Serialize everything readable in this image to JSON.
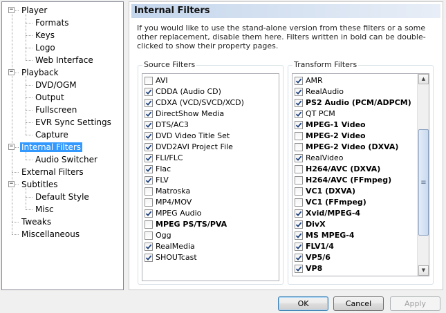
{
  "tree": {
    "items": [
      {
        "label": "Player",
        "level": 0,
        "expander": "−",
        "selected": false
      },
      {
        "label": "Formats",
        "level": 1,
        "selected": false
      },
      {
        "label": "Keys",
        "level": 1,
        "selected": false
      },
      {
        "label": "Logo",
        "level": 1,
        "selected": false
      },
      {
        "label": "Web Interface",
        "level": 1,
        "selected": false
      },
      {
        "label": "Playback",
        "level": 0,
        "expander": "−",
        "selected": false
      },
      {
        "label": "DVD/OGM",
        "level": 1,
        "selected": false
      },
      {
        "label": "Output",
        "level": 1,
        "selected": false
      },
      {
        "label": "Fullscreen",
        "level": 1,
        "selected": false
      },
      {
        "label": "EVR Sync Settings",
        "level": 1,
        "selected": false
      },
      {
        "label": "Capture",
        "level": 1,
        "selected": false
      },
      {
        "label": "Internal Filters",
        "level": 0,
        "expander": "−",
        "selected": true
      },
      {
        "label": "Audio Switcher",
        "level": 1,
        "selected": false
      },
      {
        "label": "External Filters",
        "level": 0,
        "selected": false
      },
      {
        "label": "Subtitles",
        "level": 0,
        "expander": "−",
        "selected": false
      },
      {
        "label": "Default Style",
        "level": 1,
        "selected": false
      },
      {
        "label": "Misc",
        "level": 1,
        "selected": false
      },
      {
        "label": "Tweaks",
        "level": 0,
        "selected": false
      },
      {
        "label": "Miscellaneous",
        "level": 0,
        "selected": false
      }
    ]
  },
  "page": {
    "title": "Internal Filters",
    "description": "If you would like to use the stand-alone version from these filters or a some other replacement, disable them here. Filters written in bold can be double-clicked to show their property pages."
  },
  "source_filters": {
    "label": "Source Filters",
    "items": [
      {
        "label": "AVI",
        "checked": false,
        "bold": false
      },
      {
        "label": "CDDA (Audio CD)",
        "checked": true,
        "bold": false
      },
      {
        "label": "CDXA (VCD/SVCD/XCD)",
        "checked": true,
        "bold": false
      },
      {
        "label": "DirectShow Media",
        "checked": true,
        "bold": false
      },
      {
        "label": "DTS/AC3",
        "checked": true,
        "bold": false
      },
      {
        "label": "DVD Video Title Set",
        "checked": true,
        "bold": false
      },
      {
        "label": "DVD2AVI Project File",
        "checked": true,
        "bold": false
      },
      {
        "label": "FLI/FLC",
        "checked": true,
        "bold": false
      },
      {
        "label": "Flac",
        "checked": true,
        "bold": false
      },
      {
        "label": "FLV",
        "checked": true,
        "bold": false
      },
      {
        "label": "Matroska",
        "checked": false,
        "bold": false
      },
      {
        "label": "MP4/MOV",
        "checked": false,
        "bold": false
      },
      {
        "label": "MPEG Audio",
        "checked": true,
        "bold": false
      },
      {
        "label": "MPEG PS/TS/PVA",
        "checked": false,
        "bold": true
      },
      {
        "label": "Ogg",
        "checked": false,
        "bold": false
      },
      {
        "label": "RealMedia",
        "checked": true,
        "bold": false
      },
      {
        "label": "SHOUTcast",
        "checked": true,
        "bold": false
      }
    ]
  },
  "transform_filters": {
    "label": "Transform Filters",
    "items": [
      {
        "label": "AMR",
        "checked": true,
        "bold": false
      },
      {
        "label": "RealAudio",
        "checked": true,
        "bold": false
      },
      {
        "label": "PS2 Audio (PCM/ADPCM)",
        "checked": true,
        "bold": true
      },
      {
        "label": "QT PCM",
        "checked": true,
        "bold": false
      },
      {
        "label": "MPEG-1 Video",
        "checked": true,
        "bold": true
      },
      {
        "label": "MPEG-2 Video",
        "checked": false,
        "bold": true
      },
      {
        "label": "MPEG-2 Video (DXVA)",
        "checked": false,
        "bold": true
      },
      {
        "label": "RealVideo",
        "checked": true,
        "bold": false
      },
      {
        "label": "H264/AVC (DXVA)",
        "checked": false,
        "bold": true
      },
      {
        "label": "H264/AVC (FFmpeg)",
        "checked": false,
        "bold": true
      },
      {
        "label": "VC1 (DXVA)",
        "checked": false,
        "bold": true
      },
      {
        "label": "VC1 (FFmpeg)",
        "checked": false,
        "bold": true
      },
      {
        "label": "Xvid/MPEG-4",
        "checked": true,
        "bold": true
      },
      {
        "label": "DivX",
        "checked": true,
        "bold": true
      },
      {
        "label": "MS MPEG-4",
        "checked": true,
        "bold": true
      },
      {
        "label": "FLV1/4",
        "checked": true,
        "bold": true
      },
      {
        "label": "VP5/6",
        "checked": true,
        "bold": true
      },
      {
        "label": "VP8",
        "checked": true,
        "bold": true
      }
    ]
  },
  "buttons": {
    "ok": "OK",
    "cancel": "Cancel",
    "apply": "Apply"
  },
  "icons": {
    "scroll_up": "scroll-up-arrow-icon",
    "scroll_down": "scroll-down-arrow-icon",
    "check": "check-icon"
  }
}
